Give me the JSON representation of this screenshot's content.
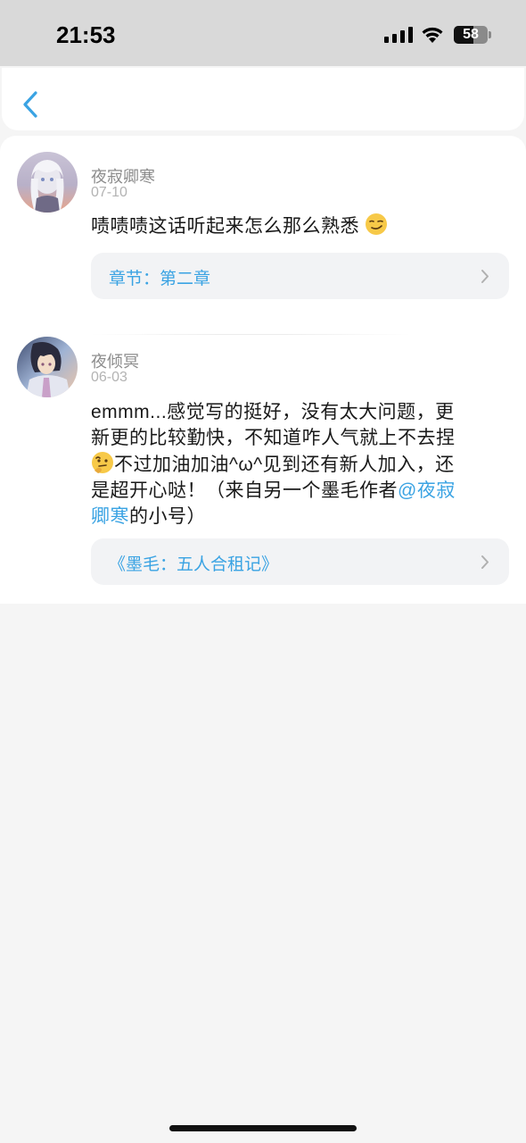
{
  "status_bar": {
    "time": "21:53",
    "battery_level": "58",
    "battery_fraction": 0.58
  },
  "nav": {
    "back_icon": "chevron-left-icon",
    "accent_color": "#3aa3e3"
  },
  "comments": [
    {
      "username": "夜寂卿寒",
      "date": "07-10",
      "text": "啧啧啧这话听起来怎么那么熟悉",
      "emoji": "smirking-face",
      "link_label": "章节：第二章"
    },
    {
      "username": "夜倾冥",
      "date": "06-03",
      "text_line1": "emmm...感觉写的挺好，没有太大问题，更",
      "text_line2": "新更的比较勤快，不知道咋人气就上不去捏",
      "emoji": "thinking-face",
      "text_line3": "不过加油加油^ω^见到还有新人加入，还",
      "text_line4a": "是超开心哒！（来自另一个墨毛作者",
      "mention_a": "@夜寂",
      "mention_b": "卿寒",
      "text_line5": "的小号）",
      "link_label": "《墨毛：五人合租记》"
    }
  ]
}
